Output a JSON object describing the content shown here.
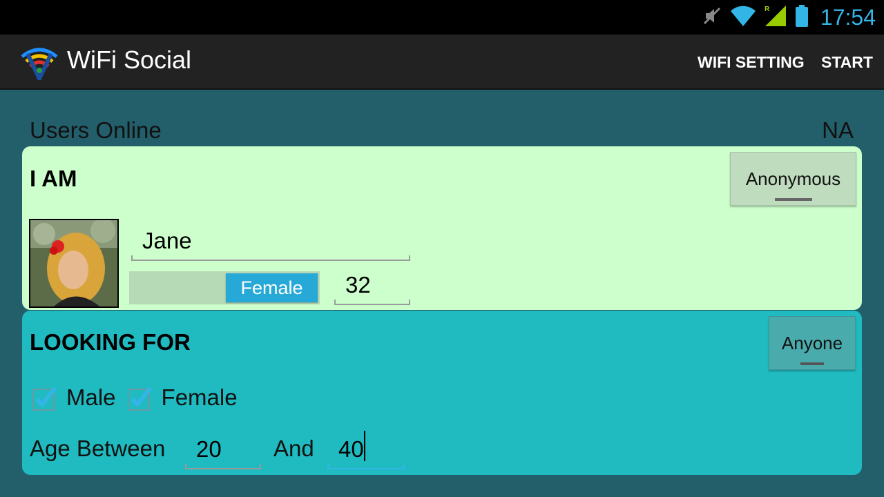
{
  "status_bar": {
    "time": "17:54",
    "icons": [
      "mute-icon",
      "wifi-signal-icon",
      "cell-signal-icon",
      "battery-icon"
    ],
    "accent_color": "#33b5e5"
  },
  "action_bar": {
    "title": "WiFi Social",
    "actions": {
      "wifi_setting": "WIFI SETTING",
      "start": "START"
    }
  },
  "users_online": {
    "label": "Users Online",
    "value": "NA"
  },
  "i_am": {
    "title": "I AM",
    "mode_button": "Anonymous",
    "name": "Jane",
    "gender": "Female",
    "age": "32"
  },
  "looking_for": {
    "title": "LOOKING FOR",
    "mode_button": "Anyone",
    "male_label": "Male",
    "male_checked": true,
    "female_label": "Female",
    "female_checked": true,
    "age_between_label": "Age Between",
    "age_from": "20",
    "and_label": "And",
    "age_to": "40"
  },
  "colors": {
    "background": "#235e6b",
    "green_panel": "#ccffcc",
    "teal_panel": "#1fbbc1",
    "toggle_on": "#27a9d7"
  }
}
